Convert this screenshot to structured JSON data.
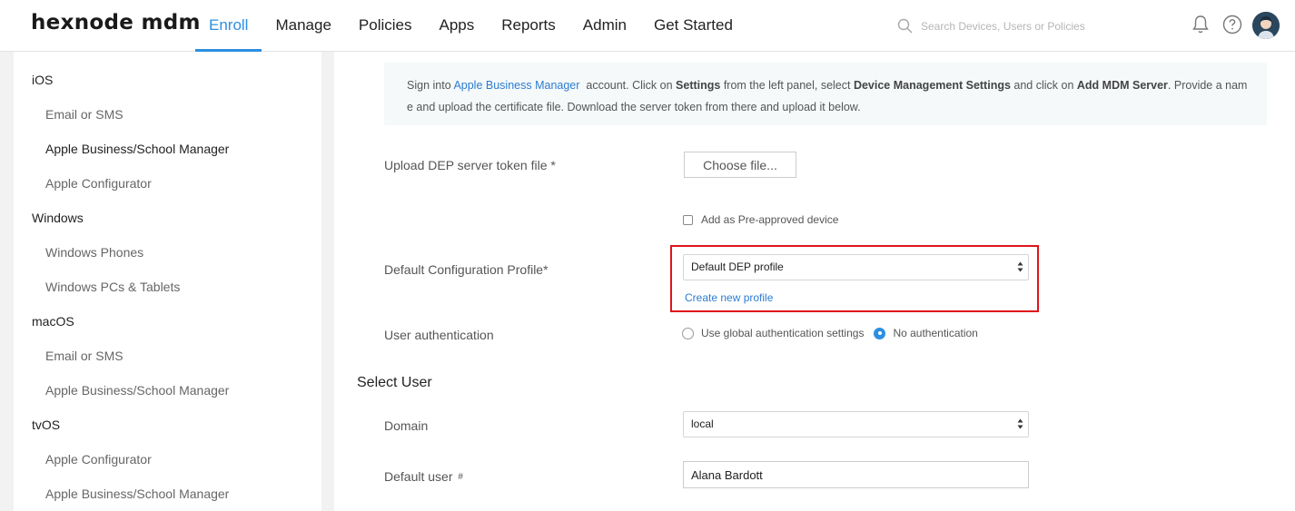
{
  "app": {
    "logo": "hexnode mdm"
  },
  "nav": [
    "Enroll",
    "Manage",
    "Policies",
    "Apps",
    "Reports",
    "Admin",
    "Get Started"
  ],
  "search": {
    "placeholder": "Search Devices, Users or Policies"
  },
  "sidebar": {
    "items": [
      {
        "label": "iOS",
        "level": "group"
      },
      {
        "label": "Email or SMS",
        "level": "sub"
      },
      {
        "label": "Apple Business/School Manager",
        "level": "sub",
        "active": true
      },
      {
        "label": "Apple Configurator",
        "level": "sub"
      },
      {
        "label": "Windows",
        "level": "group"
      },
      {
        "label": "Windows Phones",
        "level": "sub"
      },
      {
        "label": "Windows PCs & Tablets",
        "level": "sub"
      },
      {
        "label": "macOS",
        "level": "group"
      },
      {
        "label": "Email or SMS",
        "level": "sub"
      },
      {
        "label": "Apple Business/School Manager",
        "level": "sub"
      },
      {
        "label": "tvOS",
        "level": "group"
      },
      {
        "label": "Apple Configurator",
        "level": "sub"
      },
      {
        "label": "Apple Business/School Manager",
        "level": "sub"
      }
    ]
  },
  "info": {
    "t1": "Sign into ",
    "link": "Apple Business Manager",
    "t2": "  account. Click on ",
    "b1": "Settings",
    "t3": " from the left panel, select ",
    "b2": "Device Management Settings",
    "t4": " and click on ",
    "b3": "Add MDM Server",
    "t5": ". Provide a nam",
    "t6": "e and upload the certificate file. Download the server token from there and upload it below."
  },
  "form": {
    "upload_label": "Upload DEP server token file *",
    "choose_file": "Choose file...",
    "preapproved_label": "Add as Pre-approved device",
    "profile_label": "Default Configuration Profile*",
    "profile_value": "Default DEP profile",
    "create_profile": "Create new profile",
    "auth_label": "User authentication",
    "auth_options": [
      "Use global authentication settings",
      "No authentication"
    ],
    "auth_selected": "No authentication",
    "select_user_title": "Select User",
    "domain_label": "Domain",
    "domain_value": "local",
    "default_user_label": "Default user",
    "default_user_hash": "#",
    "default_user_value": "Alana Bardott"
  },
  "colors": {
    "accent": "#2d8fe0",
    "highlight": "#e0131b",
    "link": "#2d7cd1"
  }
}
